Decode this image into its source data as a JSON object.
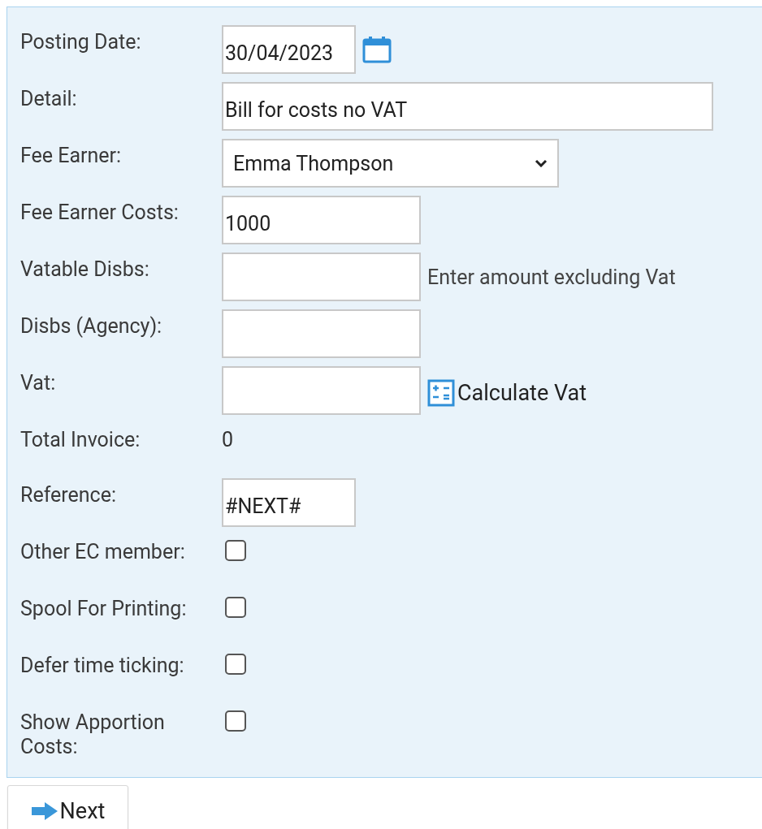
{
  "form": {
    "rows": [
      {
        "kind": "date",
        "label": "Posting Date:",
        "value": "30/04/2023"
      },
      {
        "kind": "detail",
        "label": "Detail:",
        "value": "Bill for costs no VAT"
      },
      {
        "kind": "select",
        "label": "Fee Earner:",
        "value": "Emma Thompson"
      },
      {
        "kind": "amount",
        "label": "Fee Earner Costs:",
        "value": "1000"
      },
      {
        "kind": "amount",
        "label": "Vatable Disbs:",
        "hint": "Enter amount excluding Vat"
      },
      {
        "kind": "amount",
        "label": "Disbs (Agency):"
      },
      {
        "kind": "calc",
        "label": "Vat:",
        "action": "Calculate Vat"
      },
      {
        "kind": "value",
        "label": "Total Invoice:",
        "value": "0"
      },
      {
        "kind": "reference",
        "label": "Reference:",
        "value": "#NEXT#"
      },
      {
        "kind": "checkbox",
        "label": "Other EC member:",
        "checked": false
      },
      {
        "kind": "checkbox",
        "label": "Spool For Printing:",
        "checked": false
      },
      {
        "kind": "checkbox",
        "label": "Defer time ticking:",
        "checked": false
      },
      {
        "kind": "checkbox",
        "label": "Show Apportion Costs:",
        "checked": false
      }
    ]
  },
  "next_button": {
    "label": "Next"
  }
}
